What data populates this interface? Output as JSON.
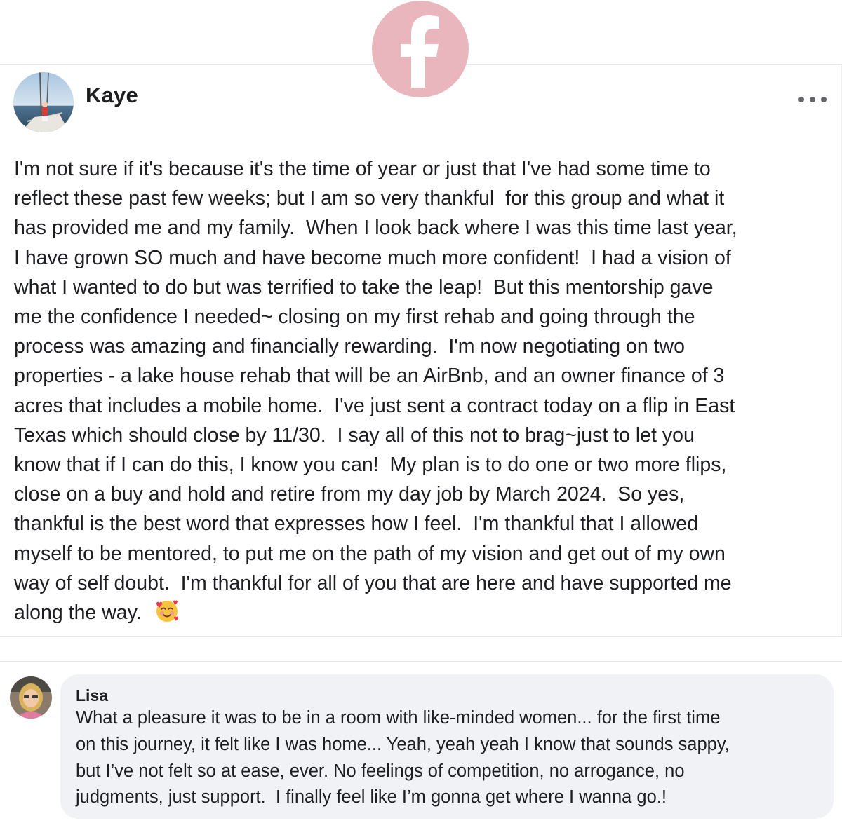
{
  "brand": {
    "logo_icon": "facebook-f-icon",
    "logo_color": "#e8b6bc"
  },
  "post": {
    "author": "Kaye",
    "avatar_icon": "profile-photo-sailboat",
    "menu_icon": "more-options-icon",
    "lines": [
      "I'm not sure if it's because it's the time of year or just that I've had some time to",
      "reflect these past few weeks; but I am so very thankful  for this group and what it",
      "has provided me and my family.  When I look back where I was this time last year,",
      "I have grown SO much and have become much more confident!  I had a vision of",
      "what I wanted to do but was terrified to take the leap!  But this mentorship gave",
      "me the confidence I needed~ closing on my first rehab and going through the",
      "process was amazing and financially rewarding.  I'm now negotiating on two",
      "properties - a lake house rehab that will be an AirBnb, and an owner finance of 3",
      "acres that includes a mobile home.  I've just sent a contract today on a flip in East",
      "Texas which should close by 11/30.  I say all of this not to brag~just to let you",
      "know that if I can do this, I know you can!  My plan is to do one or two more flips,",
      "close on a buy and hold and retire from my day job by March 2024.  So yes,",
      "thankful is the best word that expresses how I feel.  I'm thankful that I allowed",
      "myself to be mentored, to put me on the path of my vision and get out of my own",
      "way of self doubt.  I'm thankful for all of you that are here and have supported me",
      "along the way."
    ],
    "emoji_icon": "smiling-face-with-hearts-emoji"
  },
  "comment": {
    "author": "Lisa",
    "avatar_icon": "profile-photo-lisa",
    "lines": [
      "What a pleasure it was to be in a room with like-minded women... for the first time",
      "on this journey, it felt like I was home... Yeah, yeah yeah I know that sounds sappy,",
      "but I’ve not felt so at ease, ever. No feelings of competition, no arrogance, no",
      "judgments, just support.  I finally feel like I’m gonna get where I wanna go.!"
    ]
  }
}
